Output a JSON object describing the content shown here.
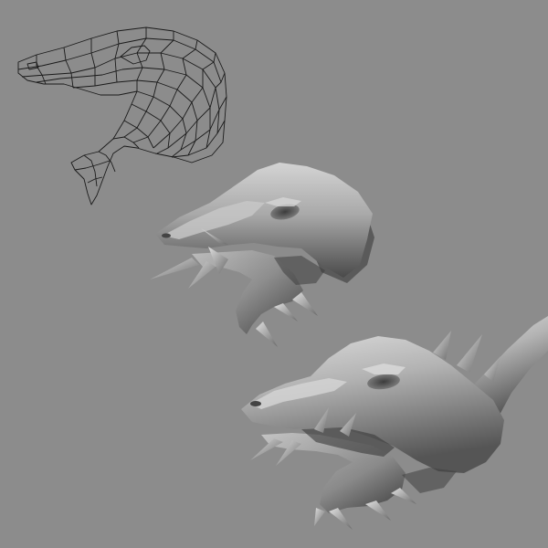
{
  "viewport": {
    "background_color": "#8c8c8c"
  },
  "models": [
    {
      "id": "wireframe",
      "shading": "wireframe",
      "stage": 1,
      "line_color": "#1a1a1a"
    },
    {
      "id": "low-poly",
      "shading": "smooth-shaded",
      "stage": 2,
      "base_color": "#a8a8a8"
    },
    {
      "id": "high-res",
      "shading": "smooth-shaded",
      "stage": 3,
      "base_color": "#aeaeae"
    }
  ]
}
